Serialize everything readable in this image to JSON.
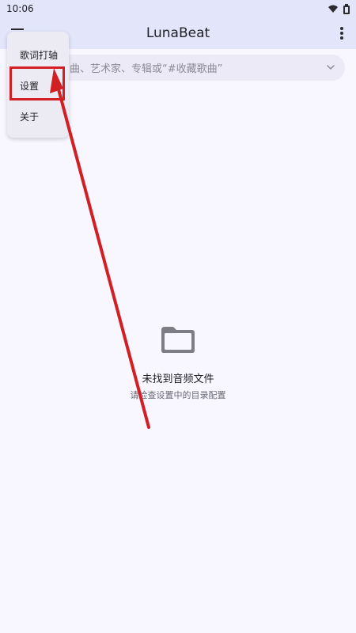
{
  "status_bar": {
    "time": "10:06",
    "icons": [
      "wifi-icon",
      "battery-icon"
    ]
  },
  "app_bar": {
    "title": "LunaBeat",
    "leading_icon": "menu-icon",
    "trailing_icon": "more-vert-icon"
  },
  "search": {
    "placeholder": "曲、艺术家、专辑或“#收藏歌曲”",
    "trailing_icon": "chevron-down-icon"
  },
  "popup_menu": {
    "items": [
      {
        "label": "歌词打轴"
      },
      {
        "label": "设置"
      },
      {
        "label": "关于"
      }
    ]
  },
  "empty_state": {
    "icon": "folder-icon",
    "title": "未找到音频文件",
    "subtitle": "请检查设置中的目录配置"
  },
  "colors": {
    "header_bg": "#e3e6fb",
    "background": "#f8f7ff",
    "search_bg": "#eceaf7",
    "menu_bg": "#eceaf2",
    "annotation": "#d21f24",
    "folder_icon": "#7d7d86"
  }
}
